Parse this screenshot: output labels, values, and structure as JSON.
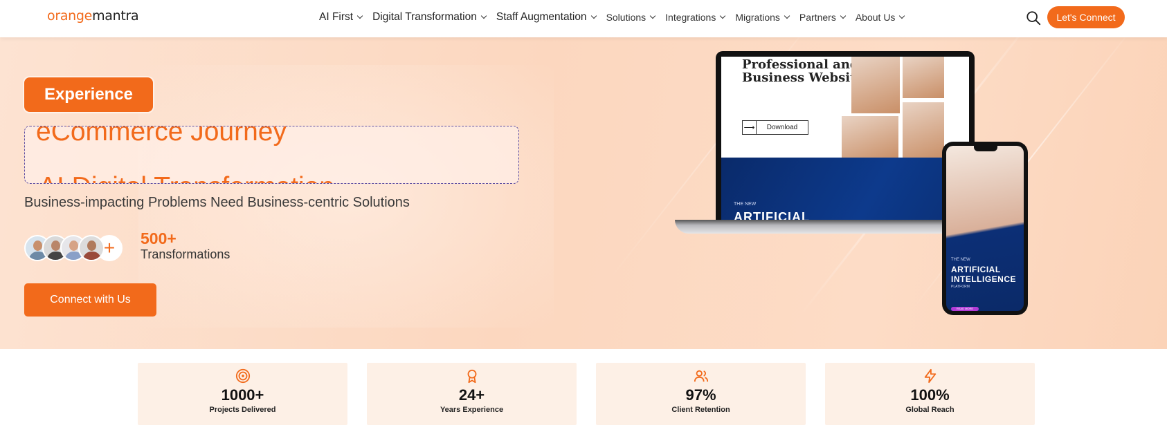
{
  "header": {
    "logo": {
      "part1": "orange",
      "part2": "mantra"
    },
    "nav": [
      {
        "label": "AI First",
        "size": "big"
      },
      {
        "label": "Digital Transformation",
        "size": "big"
      },
      {
        "label": "Staff Augmentation",
        "size": "big"
      },
      {
        "label": "Solutions",
        "size": "small"
      },
      {
        "label": "Integrations",
        "size": "small"
      },
      {
        "label": "Migrations",
        "size": "small"
      },
      {
        "label": "Partners",
        "size": "small"
      },
      {
        "label": "About Us",
        "size": "small"
      }
    ],
    "search_icon": "search-icon",
    "cta_label": "Let's Connect"
  },
  "hero": {
    "badge": "Experience",
    "rotating_line1": "eCommerce Journey",
    "rotating_line2": "AI Digital Transformation",
    "subtitle": "Business-impacting Problems Need Business-centric Solutions",
    "stat_number": "500+",
    "stat_label": "Transformations",
    "cta_label": "Connect with Us",
    "laptop": {
      "title_line1": "Professional and",
      "title_line2": "Business Website",
      "download": "Download",
      "new_label": "THE NEW",
      "ai_label": "ARTIFICIAL"
    },
    "phone": {
      "new_label": "THE NEW",
      "ai_line1": "ARTIFICIAL",
      "ai_line2": "INTELLIGENCE",
      "platform": "PLATFORM",
      "more": "READ MORE"
    }
  },
  "stats": [
    {
      "icon": "target-icon",
      "value": "1000+",
      "label": "Projects Delivered"
    },
    {
      "icon": "award-icon",
      "value": "24+",
      "label": "Years Experience"
    },
    {
      "icon": "users-icon",
      "value": "97%",
      "label": "Client Retention"
    },
    {
      "icon": "lightning-icon",
      "value": "100%",
      "label": "Global Reach"
    }
  ],
  "colors": {
    "accent": "#f26a1b",
    "hero_bg": "#fcd7bf",
    "card_bg": "#fdf0e6"
  }
}
